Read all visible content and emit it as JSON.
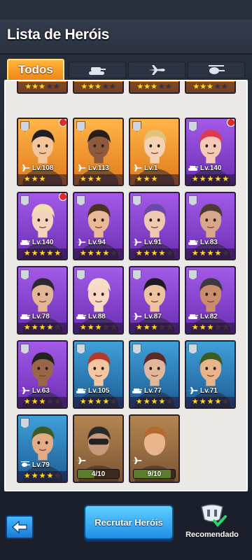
{
  "header": {
    "title": "Lista de Heróis"
  },
  "tabs": [
    {
      "label": "Todos",
      "icon": "all"
    },
    {
      "label": "",
      "icon": "tank-icon"
    },
    {
      "label": "",
      "icon": "aircraft-icon"
    },
    {
      "label": "",
      "icon": "helicopter-icon"
    }
  ],
  "heroes": [
    {
      "level": "Lv.108",
      "stars": 3,
      "rarity": "orange",
      "notif": true,
      "vehicle": "aircraft"
    },
    {
      "level": "Lv.113",
      "stars": 3,
      "rarity": "orange",
      "notif": false,
      "vehicle": "aircraft"
    },
    {
      "level": "Lv.1",
      "stars": 3,
      "rarity": "orange",
      "notif": false,
      "vehicle": "aircraft"
    },
    {
      "level": "Lv.140",
      "stars": 5,
      "rarity": "purple",
      "notif": true,
      "vehicle": "tank"
    },
    {
      "level": "Lv.140",
      "stars": 5,
      "rarity": "purple",
      "notif": true,
      "vehicle": "tank"
    },
    {
      "level": "Lv.94",
      "stars": 4,
      "rarity": "purple",
      "notif": false,
      "vehicle": "aircraft"
    },
    {
      "level": "Lv.91",
      "stars": 4,
      "rarity": "purple",
      "notif": false,
      "vehicle": "aircraft"
    },
    {
      "level": "Lv.83",
      "stars": 4,
      "rarity": "purple",
      "notif": false,
      "vehicle": "tank"
    },
    {
      "level": "Lv.78",
      "stars": 4,
      "rarity": "purple",
      "notif": false,
      "vehicle": "tank"
    },
    {
      "level": "Lv.88",
      "stars": 3,
      "rarity": "purple",
      "notif": false,
      "vehicle": "tank"
    },
    {
      "level": "Lv.87",
      "stars": 3,
      "rarity": "purple",
      "notif": false,
      "vehicle": "aircraft"
    },
    {
      "level": "Lv.82",
      "stars": 3,
      "rarity": "purple",
      "notif": false,
      "vehicle": "tank"
    },
    {
      "level": "Lv.63",
      "stars": 3,
      "rarity": "purple",
      "notif": false,
      "vehicle": "aircraft"
    },
    {
      "level": "Lv.105",
      "stars": 4,
      "rarity": "blue",
      "notif": false,
      "vehicle": "tank"
    },
    {
      "level": "Lv.77",
      "stars": 4,
      "rarity": "blue",
      "notif": false,
      "vehicle": "tank"
    },
    {
      "level": "Lv.71",
      "stars": 4,
      "rarity": "blue",
      "notif": false,
      "vehicle": "aircraft"
    },
    {
      "level": "Lv.79",
      "stars": 4,
      "rarity": "blue",
      "notif": false,
      "vehicle": "helicopter"
    }
  ],
  "locked": [
    {
      "progress": "4/10",
      "vehicle": "aircraft"
    },
    {
      "progress": "9/10",
      "vehicle": "aircraft"
    }
  ],
  "footer": {
    "recruit_label": "Recrutar Heróis",
    "recommend_label": "Recomendado"
  }
}
